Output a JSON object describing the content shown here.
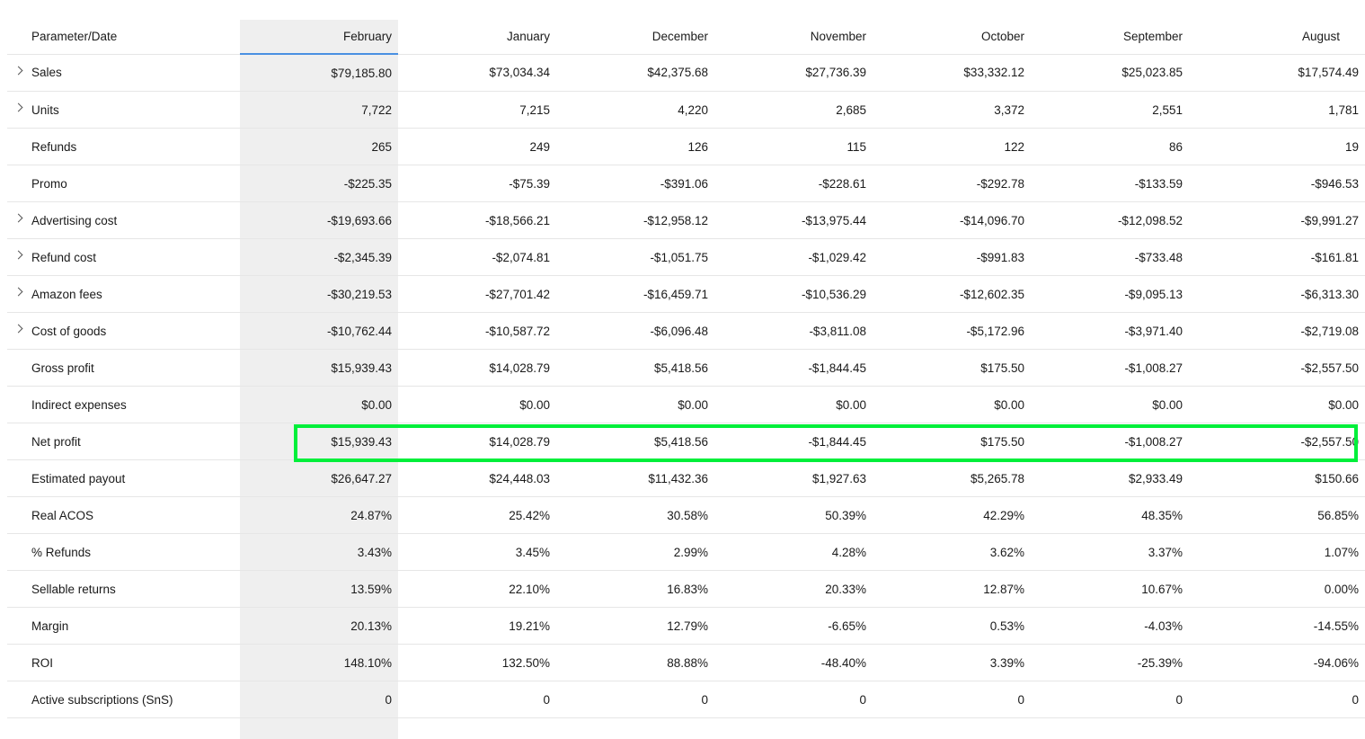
{
  "table": {
    "param_header": "Parameter/Date",
    "months": [
      "February",
      "January",
      "December",
      "November",
      "October",
      "September",
      "August"
    ],
    "rows": [
      {
        "label": "Sales",
        "expandable": true,
        "values": [
          "$79,185.80",
          "$73,034.34",
          "$42,375.68",
          "$27,736.39",
          "$33,332.12",
          "$25,023.85",
          "$17,574.49"
        ]
      },
      {
        "label": "Units",
        "expandable": true,
        "values": [
          "7,722",
          "7,215",
          "4,220",
          "2,685",
          "3,372",
          "2,551",
          "1,781"
        ]
      },
      {
        "label": "Refunds",
        "expandable": false,
        "values": [
          "265",
          "249",
          "126",
          "115",
          "122",
          "86",
          "19"
        ]
      },
      {
        "label": "Promo",
        "expandable": false,
        "values": [
          "-$225.35",
          "-$75.39",
          "-$391.06",
          "-$228.61",
          "-$292.78",
          "-$133.59",
          "-$946.53"
        ]
      },
      {
        "label": "Advertising cost",
        "expandable": true,
        "values": [
          "-$19,693.66",
          "-$18,566.21",
          "-$12,958.12",
          "-$13,975.44",
          "-$14,096.70",
          "-$12,098.52",
          "-$9,991.27"
        ]
      },
      {
        "label": "Refund cost",
        "expandable": true,
        "values": [
          "-$2,345.39",
          "-$2,074.81",
          "-$1,051.75",
          "-$1,029.42",
          "-$991.83",
          "-$733.48",
          "-$161.81"
        ]
      },
      {
        "label": "Amazon fees",
        "expandable": true,
        "values": [
          "-$30,219.53",
          "-$27,701.42",
          "-$16,459.71",
          "-$10,536.29",
          "-$12,602.35",
          "-$9,095.13",
          "-$6,313.30"
        ]
      },
      {
        "label": "Cost of goods",
        "expandable": true,
        "values": [
          "-$10,762.44",
          "-$10,587.72",
          "-$6,096.48",
          "-$3,811.08",
          "-$5,172.96",
          "-$3,971.40",
          "-$2,719.08"
        ]
      },
      {
        "label": "Gross profit",
        "expandable": false,
        "values": [
          "$15,939.43",
          "$14,028.79",
          "$5,418.56",
          "-$1,844.45",
          "$175.50",
          "-$1,008.27",
          "-$2,557.50"
        ]
      },
      {
        "label": "Indirect expenses",
        "expandable": false,
        "values": [
          "$0.00",
          "$0.00",
          "$0.00",
          "$0.00",
          "$0.00",
          "$0.00",
          "$0.00"
        ]
      },
      {
        "label": "Net profit",
        "expandable": false,
        "values": [
          "$15,939.43",
          "$14,028.79",
          "$5,418.56",
          "-$1,844.45",
          "$175.50",
          "-$1,008.27",
          "-$2,557.50"
        ]
      },
      {
        "label": "Estimated payout",
        "expandable": false,
        "values": [
          "$26,647.27",
          "$24,448.03",
          "$11,432.36",
          "$1,927.63",
          "$5,265.78",
          "$2,933.49",
          "$150.66"
        ]
      },
      {
        "label": "Real ACOS",
        "expandable": false,
        "values": [
          "24.87%",
          "25.42%",
          "30.58%",
          "50.39%",
          "42.29%",
          "48.35%",
          "56.85%"
        ]
      },
      {
        "label": "% Refunds",
        "expandable": false,
        "values": [
          "3.43%",
          "3.45%",
          "2.99%",
          "4.28%",
          "3.62%",
          "3.37%",
          "1.07%"
        ]
      },
      {
        "label": "Sellable returns",
        "expandable": false,
        "values": [
          "13.59%",
          "22.10%",
          "16.83%",
          "20.33%",
          "12.87%",
          "10.67%",
          "0.00%"
        ]
      },
      {
        "label": "Margin",
        "expandable": false,
        "values": [
          "20.13%",
          "19.21%",
          "12.79%",
          "-6.65%",
          "0.53%",
          "-4.03%",
          "-14.55%"
        ]
      },
      {
        "label": "ROI",
        "expandable": false,
        "values": [
          "148.10%",
          "132.50%",
          "88.88%",
          "-48.40%",
          "3.39%",
          "-25.39%",
          "-94.06%"
        ]
      },
      {
        "label": "Active subscriptions (SnS)",
        "expandable": false,
        "values": [
          "0",
          "0",
          "0",
          "0",
          "0",
          "0",
          "0"
        ]
      }
    ]
  },
  "icons": {
    "expand": "chevron-right-icon"
  },
  "colors": {
    "sorted_column_bg": "#efefef",
    "sorted_column_underline": "#4a90e2",
    "highlight_box": "#00ef3a"
  }
}
